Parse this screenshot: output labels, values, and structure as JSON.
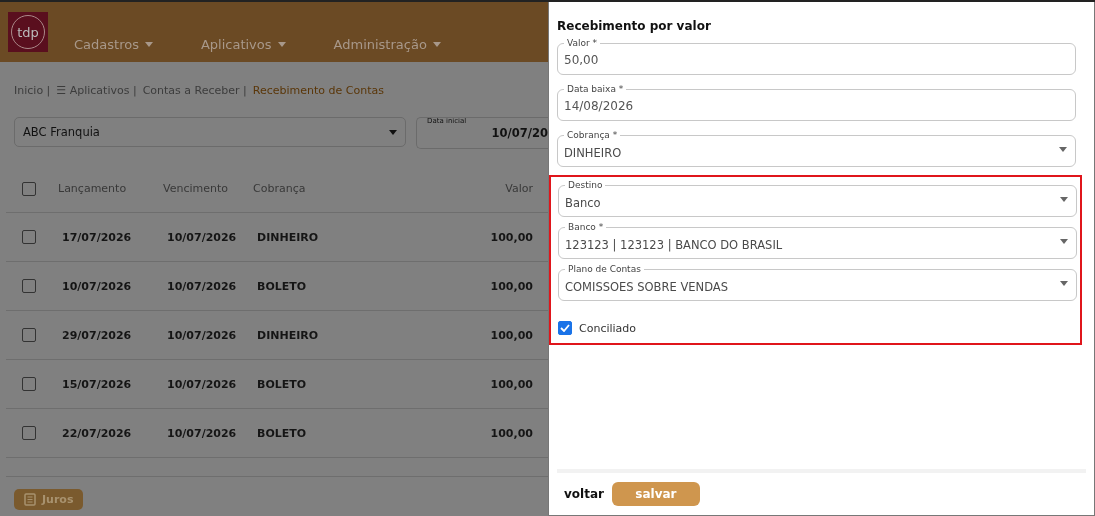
{
  "header": {
    "logo_text": "tdp",
    "menu": [
      {
        "label": "Cadastros"
      },
      {
        "label": "Aplicativos"
      },
      {
        "label": "Administração"
      }
    ]
  },
  "breadcrumb": [
    {
      "label": "Inicio |",
      "current": false
    },
    {
      "label": "☰ Aplicativos |",
      "current": false
    },
    {
      "label": "Contas a Receber |",
      "current": false
    },
    {
      "label": "Recebimento de Contas",
      "current": true
    }
  ],
  "filters": {
    "company": {
      "value": "ABC Franquia"
    },
    "start_date": {
      "label": "Data inicial",
      "value": "10/07/20"
    }
  },
  "table": {
    "header_checked": false,
    "columns": [
      "Lançamento",
      "Vencimento",
      "Cobrança",
      "Valor"
    ],
    "rows": [
      {
        "checked": false,
        "cells": [
          "17/07/2026",
          "10/07/2026",
          "DINHEIRO",
          "100,00"
        ]
      },
      {
        "checked": false,
        "cells": [
          "10/07/2026",
          "10/07/2026",
          "BOLETO",
          "100,00"
        ]
      },
      {
        "checked": false,
        "cells": [
          "29/07/2026",
          "10/07/2026",
          "DINHEIRO",
          "100,00"
        ]
      },
      {
        "checked": false,
        "cells": [
          "15/07/2026",
          "10/07/2026",
          "BOLETO",
          "100,00"
        ]
      },
      {
        "checked": false,
        "cells": [
          "22/07/2026",
          "10/07/2026",
          "BOLETO",
          "100,00"
        ]
      }
    ]
  },
  "juros_button": {
    "label": "Juros"
  },
  "drawer": {
    "title": "Recebimento por valor",
    "fields": [
      {
        "kind": "input",
        "label": "Valor *",
        "value": "50,00"
      },
      {
        "kind": "input",
        "label": "Data baixa *",
        "value": "14/08/2026"
      },
      {
        "kind": "select",
        "label": "Cobrança *",
        "value": "DINHEIRO"
      }
    ],
    "highlight": {
      "fields": [
        {
          "kind": "select",
          "label": "Destino",
          "value": "Banco"
        },
        {
          "kind": "select",
          "label": "Banco *",
          "value": "123123 | 123123 | BANCO DO BRASIL"
        },
        {
          "kind": "select",
          "label": "Plano de Contas",
          "value": "COMISSOES SOBRE VENDAS"
        }
      ],
      "checkbox": {
        "label": "Conciliado",
        "checked": true
      }
    },
    "buttons": [
      {
        "kind": "text",
        "label": "voltar"
      },
      {
        "kind": "primary",
        "label": "salvar"
      }
    ]
  }
}
